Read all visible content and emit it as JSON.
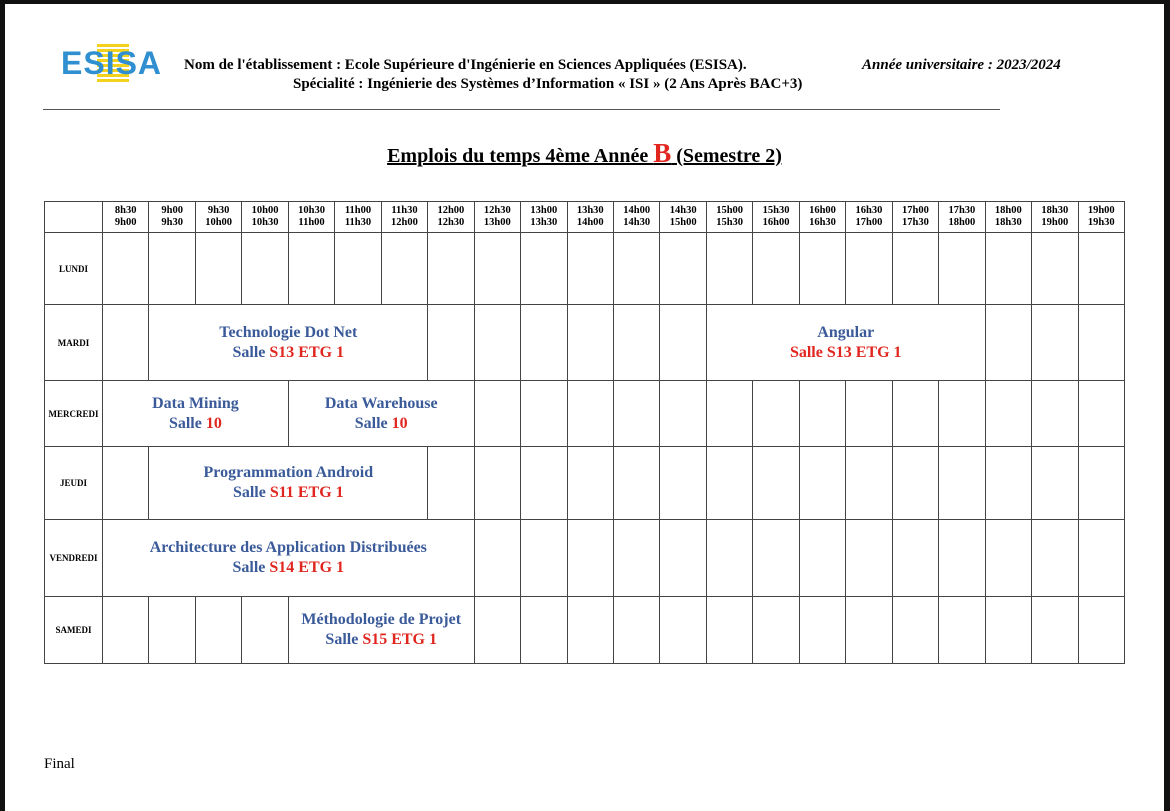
{
  "header": {
    "logo_text": "ESISA",
    "etablissement": "Nom de l'établissement : Ecole Supérieure d'Ingénierie en Sciences Appliquées (ESISA).",
    "annee": "Année universitaire : 2023/2024",
    "specialite": "Spécialité : Ingénierie des Systèmes d’Information « ISI » (2 Ans Après BAC+3)"
  },
  "title": {
    "prefix": "Emplois du temps 4ème Année ",
    "group": "B",
    "suffix": " (Semestre 2)"
  },
  "slots": [
    [
      "8h30",
      "9h00"
    ],
    [
      "9h00",
      "9h30"
    ],
    [
      "9h30",
      "10h00"
    ],
    [
      "10h00",
      "10h30"
    ],
    [
      "10h30",
      "11h00"
    ],
    [
      "11h00",
      "11h30"
    ],
    [
      "11h30",
      "12h00"
    ],
    [
      "12h00",
      "12h30"
    ],
    [
      "12h30",
      "13h00"
    ],
    [
      "13h00",
      "13h30"
    ],
    [
      "13h30",
      "14h00"
    ],
    [
      "14h00",
      "14h30"
    ],
    [
      "14h30",
      "15h00"
    ],
    [
      "15h00",
      "15h30"
    ],
    [
      "15h30",
      "16h00"
    ],
    [
      "16h00",
      "16h30"
    ],
    [
      "16h30",
      "17h00"
    ],
    [
      "17h00",
      "17h30"
    ],
    [
      "17h30",
      "18h00"
    ],
    [
      "18h00",
      "18h30"
    ],
    [
      "18h30",
      "19h00"
    ],
    [
      "19h00",
      "19h30"
    ]
  ],
  "days": [
    {
      "name": "LUNDI",
      "sessions": []
    },
    {
      "name": "MARDI",
      "sessions": [
        {
          "start": 1,
          "span": 6,
          "course": "Technologie Dot Net",
          "salle_label": "Salle ",
          "salle": "S13 ETG 1"
        },
        {
          "start": 13,
          "span": 6,
          "course": "Angular",
          "salle_label": "",
          "salle": "Salle S13 ETG 1"
        }
      ]
    },
    {
      "name": "MERCREDI",
      "sessions": [
        {
          "start": 0,
          "span": 4,
          "course": "Data Mining",
          "salle_label": "Salle ",
          "salle": "10"
        },
        {
          "start": 4,
          "span": 4,
          "course": "Data Warehouse",
          "salle_label": "Salle ",
          "salle": "10"
        }
      ]
    },
    {
      "name": "JEUDI",
      "sessions": [
        {
          "start": 1,
          "span": 6,
          "course": "Programmation Android",
          "salle_label": "Salle ",
          "salle": "S11 ETG 1"
        }
      ]
    },
    {
      "name": "VENDREDI",
      "sessions": [
        {
          "start": 0,
          "span": 8,
          "course": "Architecture des Application Distribuées",
          "salle_label": "Salle ",
          "salle": "S14 ETG 1"
        }
      ]
    },
    {
      "name": "SAMEDI",
      "sessions": [
        {
          "start": 4,
          "span": 4,
          "course": "Méthodologie de Projet",
          "salle_label": "Salle ",
          "salle": "S15 ETG 1"
        }
      ]
    }
  ],
  "footer": "Final"
}
